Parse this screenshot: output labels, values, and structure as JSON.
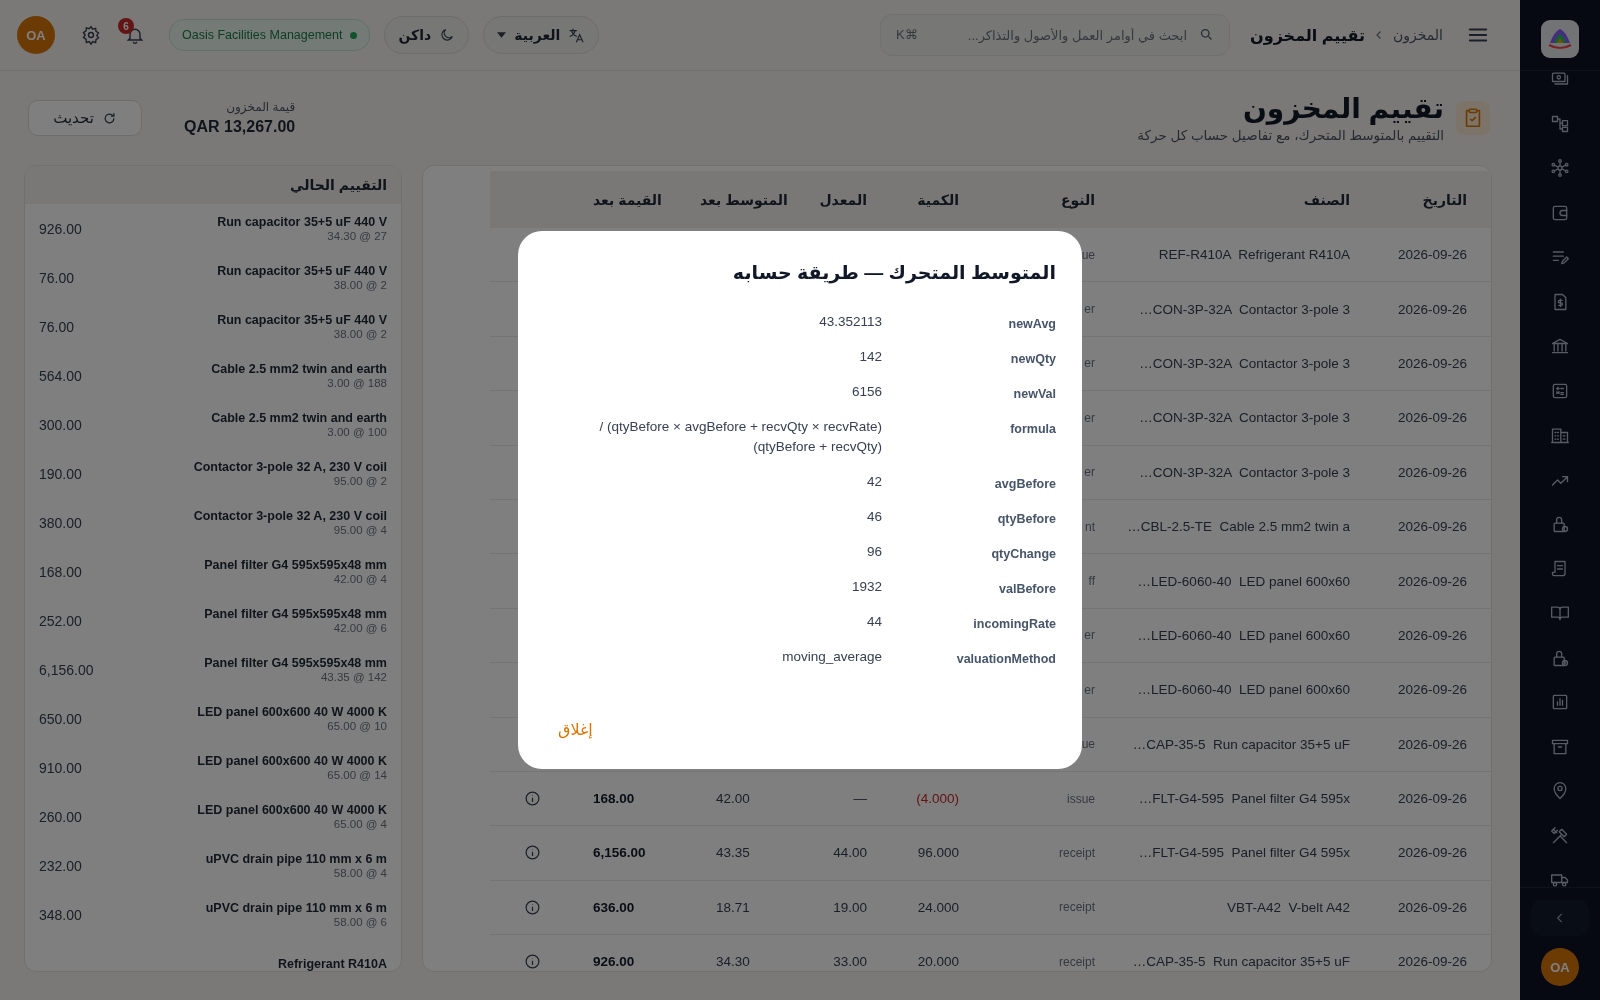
{
  "topbar": {
    "breadcrumb": [
      {
        "label": "المخزون",
        "current": false
      },
      {
        "label": "تقييم المخزون",
        "current": true
      }
    ],
    "search": {
      "placeholder": "ابحث في أوامر العمل والأصول والتذاكر...",
      "shortcut": "⌘K"
    },
    "language": "العربية",
    "theme": "داكن",
    "organization": "Oasis Facilities Management",
    "notifications": "6",
    "user": "OA"
  },
  "header": {
    "title": "تقييم المخزون",
    "subtitle": "التقييم بالمتوسط المتحرك، مع تفاصيل حساب كل حركة",
    "stock_value_label": "قيمة المخزون",
    "stock_value": "QAR 13,267.00",
    "refresh": "تحديث"
  },
  "table": {
    "columns": [
      "التاريخ",
      "الصنف",
      "النوع",
      "الكمية",
      "المعدل",
      "المتوسط بعد",
      "القيمة بعد"
    ],
    "rows": [
      {
        "date": "2026-09-26",
        "item": "REF-R410A  Refrigerant R410A",
        "type": "ue"
      },
      {
        "date": "2026-09-26",
        "item": "CON-3P-32A  Contactor 3-pole 3…",
        "type": "er"
      },
      {
        "date": "2026-09-26",
        "item": "CON-3P-32A  Contactor 3-pole 3…",
        "type": "er"
      },
      {
        "date": "2026-09-26",
        "item": "CON-3P-32A  Contactor 3-pole 3…",
        "type": "er"
      },
      {
        "date": "2026-09-26",
        "item": "CON-3P-32A  Contactor 3-pole 3…",
        "type": "er"
      },
      {
        "date": "2026-09-26",
        "item": "CBL-2.5-TE  Cable 2.5 mm2 twin a…",
        "type": "nt"
      },
      {
        "date": "2026-09-26",
        "item": "LED-6060-40  LED panel 600x60…",
        "type": "ff"
      },
      {
        "date": "2026-09-26",
        "item": "LED-6060-40  LED panel 600x60…",
        "type": "er"
      },
      {
        "date": "2026-09-26",
        "item": "LED-6060-40  LED panel 600x60…",
        "type": "er"
      },
      {
        "date": "2026-09-26",
        "item": "CAP-35-5  Run capacitor 35+5 uF…",
        "type": "ue"
      },
      {
        "date": "2026-09-26",
        "item": "FLT-G4-595  Panel filter G4 595x…",
        "type": "issue",
        "qty": "(4.000)",
        "negative": true,
        "rate": "—",
        "avg_after": "42.00",
        "value_after": "168.00"
      },
      {
        "date": "2026-09-26",
        "item": "FLT-G4-595  Panel filter G4 595x…",
        "type": "receipt",
        "qty": "96.000",
        "negative": false,
        "rate": "44.00",
        "avg_after": "43.35",
        "value_after": "6,156.00"
      },
      {
        "date": "2026-09-26",
        "item": "VBT-A42  V-belt A42",
        "type": "receipt",
        "qty": "24.000",
        "negative": false,
        "rate": "19.00",
        "avg_after": "18.71",
        "value_after": "636.00"
      },
      {
        "date": "2026-09-26",
        "item": "CAP-35-5  Run capacitor 35+5 uF…",
        "type": "receipt",
        "qty": "20.000",
        "negative": false,
        "rate": "33.00",
        "avg_after": "34.30",
        "value_after": "926.00"
      }
    ]
  },
  "current_valuation": {
    "title": "التقييم الحالي",
    "items": [
      {
        "name": "Run capacitor 35+5 uF 440 V",
        "detail": "34.30 @ 27",
        "value": "926.00"
      },
      {
        "name": "Run capacitor 35+5 uF 440 V",
        "detail": "38.00 @ 2",
        "value": "76.00"
      },
      {
        "name": "Run capacitor 35+5 uF 440 V",
        "detail": "38.00 @ 2",
        "value": "76.00"
      },
      {
        "name": "Cable 2.5 mm2 twin and earth",
        "detail": "3.00 @ 188",
        "value": "564.00"
      },
      {
        "name": "Cable 2.5 mm2 twin and earth",
        "detail": "3.00 @ 100",
        "value": "300.00"
      },
      {
        "name": "Contactor 3-pole 32 A, 230 V coil",
        "detail": "95.00 @ 2",
        "value": "190.00"
      },
      {
        "name": "Contactor 3-pole 32 A, 230 V coil",
        "detail": "95.00 @ 4",
        "value": "380.00"
      },
      {
        "name": "Panel filter G4 595x595x48 mm",
        "detail": "42.00 @ 4",
        "value": "168.00"
      },
      {
        "name": "Panel filter G4 595x595x48 mm",
        "detail": "42.00 @ 6",
        "value": "252.00"
      },
      {
        "name": "Panel filter G4 595x595x48 mm",
        "detail": "43.35 @ 142",
        "value": "6,156.00"
      },
      {
        "name": "LED panel 600x600 40 W 4000 K",
        "detail": "65.00 @ 10",
        "value": "650.00"
      },
      {
        "name": "LED panel 600x600 40 W 4000 K",
        "detail": "65.00 @ 14",
        "value": "910.00"
      },
      {
        "name": "LED panel 600x600 40 W 4000 K",
        "detail": "65.00 @ 4",
        "value": "260.00"
      },
      {
        "name": "uPVC drain pipe 110 mm x 6 m",
        "detail": "58.00 @ 4",
        "value": "232.00"
      },
      {
        "name": "uPVC drain pipe 110 mm x 6 m",
        "detail": "58.00 @ 6",
        "value": "348.00"
      },
      {
        "name": "Refrigerant R410A"
      }
    ]
  },
  "dialog": {
    "title": "المتوسط المتحرك — طريقة حسابه",
    "fields": [
      {
        "key": "newAvg",
        "value": "43.352113"
      },
      {
        "key": "newQty",
        "value": "142"
      },
      {
        "key": "newVal",
        "value": "6156"
      },
      {
        "key": "formula",
        "value": "(qtyBefore × avgBefore + recvQty × recvRate) / (qtyBefore + recvQty)"
      },
      {
        "key": "avgBefore",
        "value": "42"
      },
      {
        "key": "qtyBefore",
        "value": "46"
      },
      {
        "key": "qtyChange",
        "value": "96"
      },
      {
        "key": "valBefore",
        "value": "1932"
      },
      {
        "key": "incomingRate",
        "value": "44"
      },
      {
        "key": "valuationMethod",
        "value": "moving_average"
      }
    ],
    "close": "إغلاق"
  },
  "sidebar": {
    "user": "OA"
  }
}
